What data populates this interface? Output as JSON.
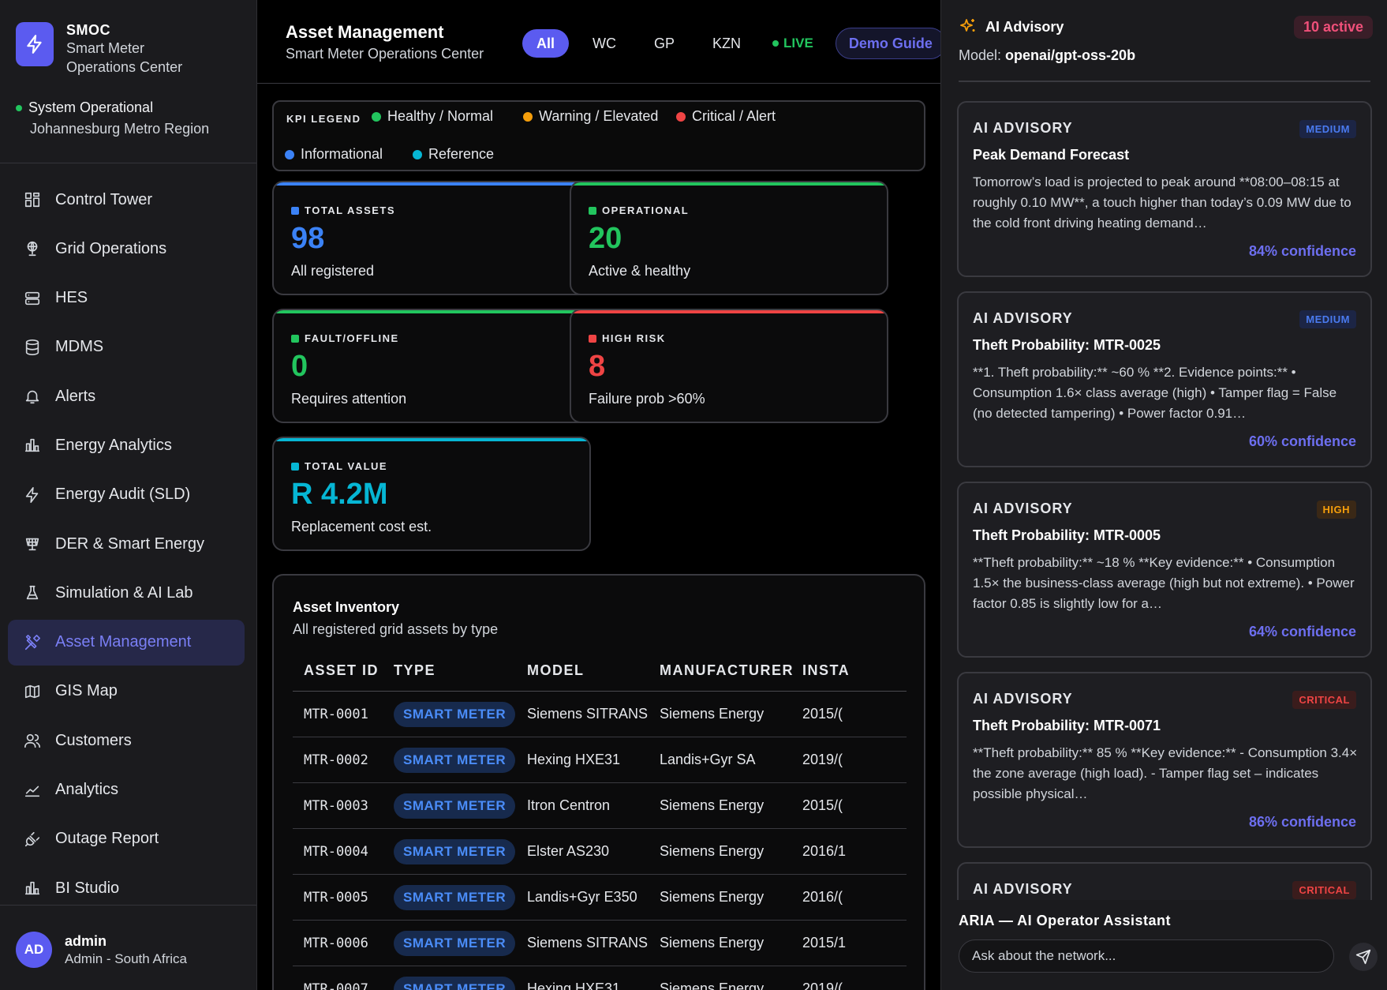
{
  "brand": {
    "short": "SMOC",
    "line1": "Smart Meter",
    "line2": "Operations Center"
  },
  "system": {
    "status": "System Operational",
    "region": "Johannesburg Metro Region",
    "status_color": "#22c55e"
  },
  "nav": {
    "items": [
      {
        "label": "Control Tower",
        "icon": "grid-icon"
      },
      {
        "label": "Grid Operations",
        "icon": "globe-icon"
      },
      {
        "label": "HES",
        "icon": "server-icon"
      },
      {
        "label": "MDMS",
        "icon": "database-icon"
      },
      {
        "label": "Alerts",
        "icon": "bell-icon"
      },
      {
        "label": "Energy Analytics",
        "icon": "bar-chart-icon"
      },
      {
        "label": "Energy Audit (SLD)",
        "icon": "bolt-icon"
      },
      {
        "label": "DER & Smart Energy",
        "icon": "solar-panel-icon"
      },
      {
        "label": "Simulation & AI Lab",
        "icon": "flask-icon"
      },
      {
        "label": "Asset Management",
        "icon": "tools-icon",
        "active": true
      },
      {
        "label": "GIS Map",
        "icon": "map-icon"
      },
      {
        "label": "Customers",
        "icon": "users-icon"
      },
      {
        "label": "Analytics",
        "icon": "line-chart-icon"
      },
      {
        "label": "Outage Report",
        "icon": "plug-icon"
      },
      {
        "label": "BI Studio",
        "icon": "bar-chart-icon"
      }
    ]
  },
  "user": {
    "initials": "AD",
    "name": "admin",
    "role": "Admin - South Africa"
  },
  "header": {
    "title": "Asset Management",
    "subtitle": "Smart Meter Operations Center",
    "tabs": [
      "All",
      "WC",
      "GP",
      "KZN"
    ],
    "live": "LIVE",
    "demo": "Demo Guide"
  },
  "legend": {
    "label": "KPI LEGEND",
    "items": [
      {
        "label": "Healthy / Normal",
        "color": "#22c55e"
      },
      {
        "label": "Warning / Elevated",
        "color": "#f59e0b"
      },
      {
        "label": "Critical / Alert",
        "color": "#ef4444"
      },
      {
        "label": "Informational",
        "color": "#3b82f6"
      },
      {
        "label": "Reference",
        "color": "#06b6d4"
      }
    ]
  },
  "kpis": [
    {
      "label": "TOTAL ASSETS",
      "value": "98",
      "caption": "All registered",
      "color": "#3b82f6"
    },
    {
      "label": "OPERATIONAL",
      "value": "20",
      "caption": "Active & healthy",
      "color": "#22c55e"
    },
    {
      "label": "FAULT/OFFLINE",
      "value": "0",
      "caption": "Requires attention",
      "color": "#22c55e"
    },
    {
      "label": "HIGH RISK",
      "value": "8",
      "caption": "Failure prob >60%",
      "color": "#ef4444"
    },
    {
      "label": "TOTAL VALUE",
      "value": "R 4.2M",
      "caption": "Replacement cost est.",
      "color": "#06b6d4"
    }
  ],
  "inventory": {
    "title": "Asset Inventory",
    "subtitle": "All registered grid assets by type",
    "columns": [
      "ASSET ID",
      "TYPE",
      "MODEL",
      "MANUFACTURER",
      "INSTA"
    ],
    "rows": [
      [
        "MTR-0001",
        "SMART METER",
        "Siemens SITRANS",
        "Siemens Energy",
        "2015/("
      ],
      [
        "MTR-0002",
        "SMART METER",
        "Hexing HXE31",
        "Landis+Gyr SA",
        "2019/("
      ],
      [
        "MTR-0003",
        "SMART METER",
        "Itron Centron",
        "Siemens Energy",
        "2015/("
      ],
      [
        "MTR-0004",
        "SMART METER",
        "Elster AS230",
        "Siemens Energy",
        "2016/1"
      ],
      [
        "MTR-0005",
        "SMART METER",
        "Landis+Gyr E350",
        "Siemens Energy",
        "2016/("
      ],
      [
        "MTR-0006",
        "SMART METER",
        "Siemens SITRANS",
        "Siemens Energy",
        "2015/1"
      ],
      [
        "MTR-0007",
        "SMART METER",
        "Hexing HXE31",
        "Siemens Energy",
        "2019/("
      ]
    ]
  },
  "advisory": {
    "title": "AI Advisory",
    "count": "10 active",
    "model_label": "Model:",
    "model": "openai/gpt-oss-20b",
    "cards": [
      {
        "kind": "AI ADVISORY",
        "severity": "MEDIUM",
        "sev": "medium",
        "title": "Peak Demand Forecast",
        "body": "Tomorrow’s load is projected to peak around **08:00–08:15 at roughly 0.10 MW**, a touch higher than today’s 0.09 MW due to the cold front driving heating demand…",
        "confidence": "84% confidence"
      },
      {
        "kind": "AI ADVISORY",
        "severity": "MEDIUM",
        "sev": "medium",
        "title": "Theft Probability: MTR-0025",
        "body": "**1. Theft probability:** ~60 % **2. Evidence points:** • Consumption 1.6× class average (high) • Tamper flag = False (no detected tampering) • Power factor 0.91…",
        "confidence": "60% confidence"
      },
      {
        "kind": "AI ADVISORY",
        "severity": "HIGH",
        "sev": "high",
        "title": "Theft Probability: MTR-0005",
        "body": "**Theft probability:** ~18 % **Key evidence:** • Consumption 1.5× the business-class average (high but not extreme). • Power factor 0.85 is slightly low for a…",
        "confidence": "64% confidence"
      },
      {
        "kind": "AI ADVISORY",
        "severity": "CRITICAL",
        "sev": "critical",
        "title": "Theft Probability: MTR-0071",
        "body": "**Theft probability:** 85 % **Key evidence:** - Consumption 3.4× the zone average (high load). - Tamper flag set – indicates possible physical…",
        "confidence": "86% confidence"
      },
      {
        "kind": "AI ADVISORY",
        "severity": "CRITICAL",
        "sev": "critical",
        "title": "",
        "body": "",
        "confidence": ""
      }
    ]
  },
  "aria": {
    "title": "ARIA — AI Operator Assistant",
    "placeholder": "Ask about the network..."
  }
}
